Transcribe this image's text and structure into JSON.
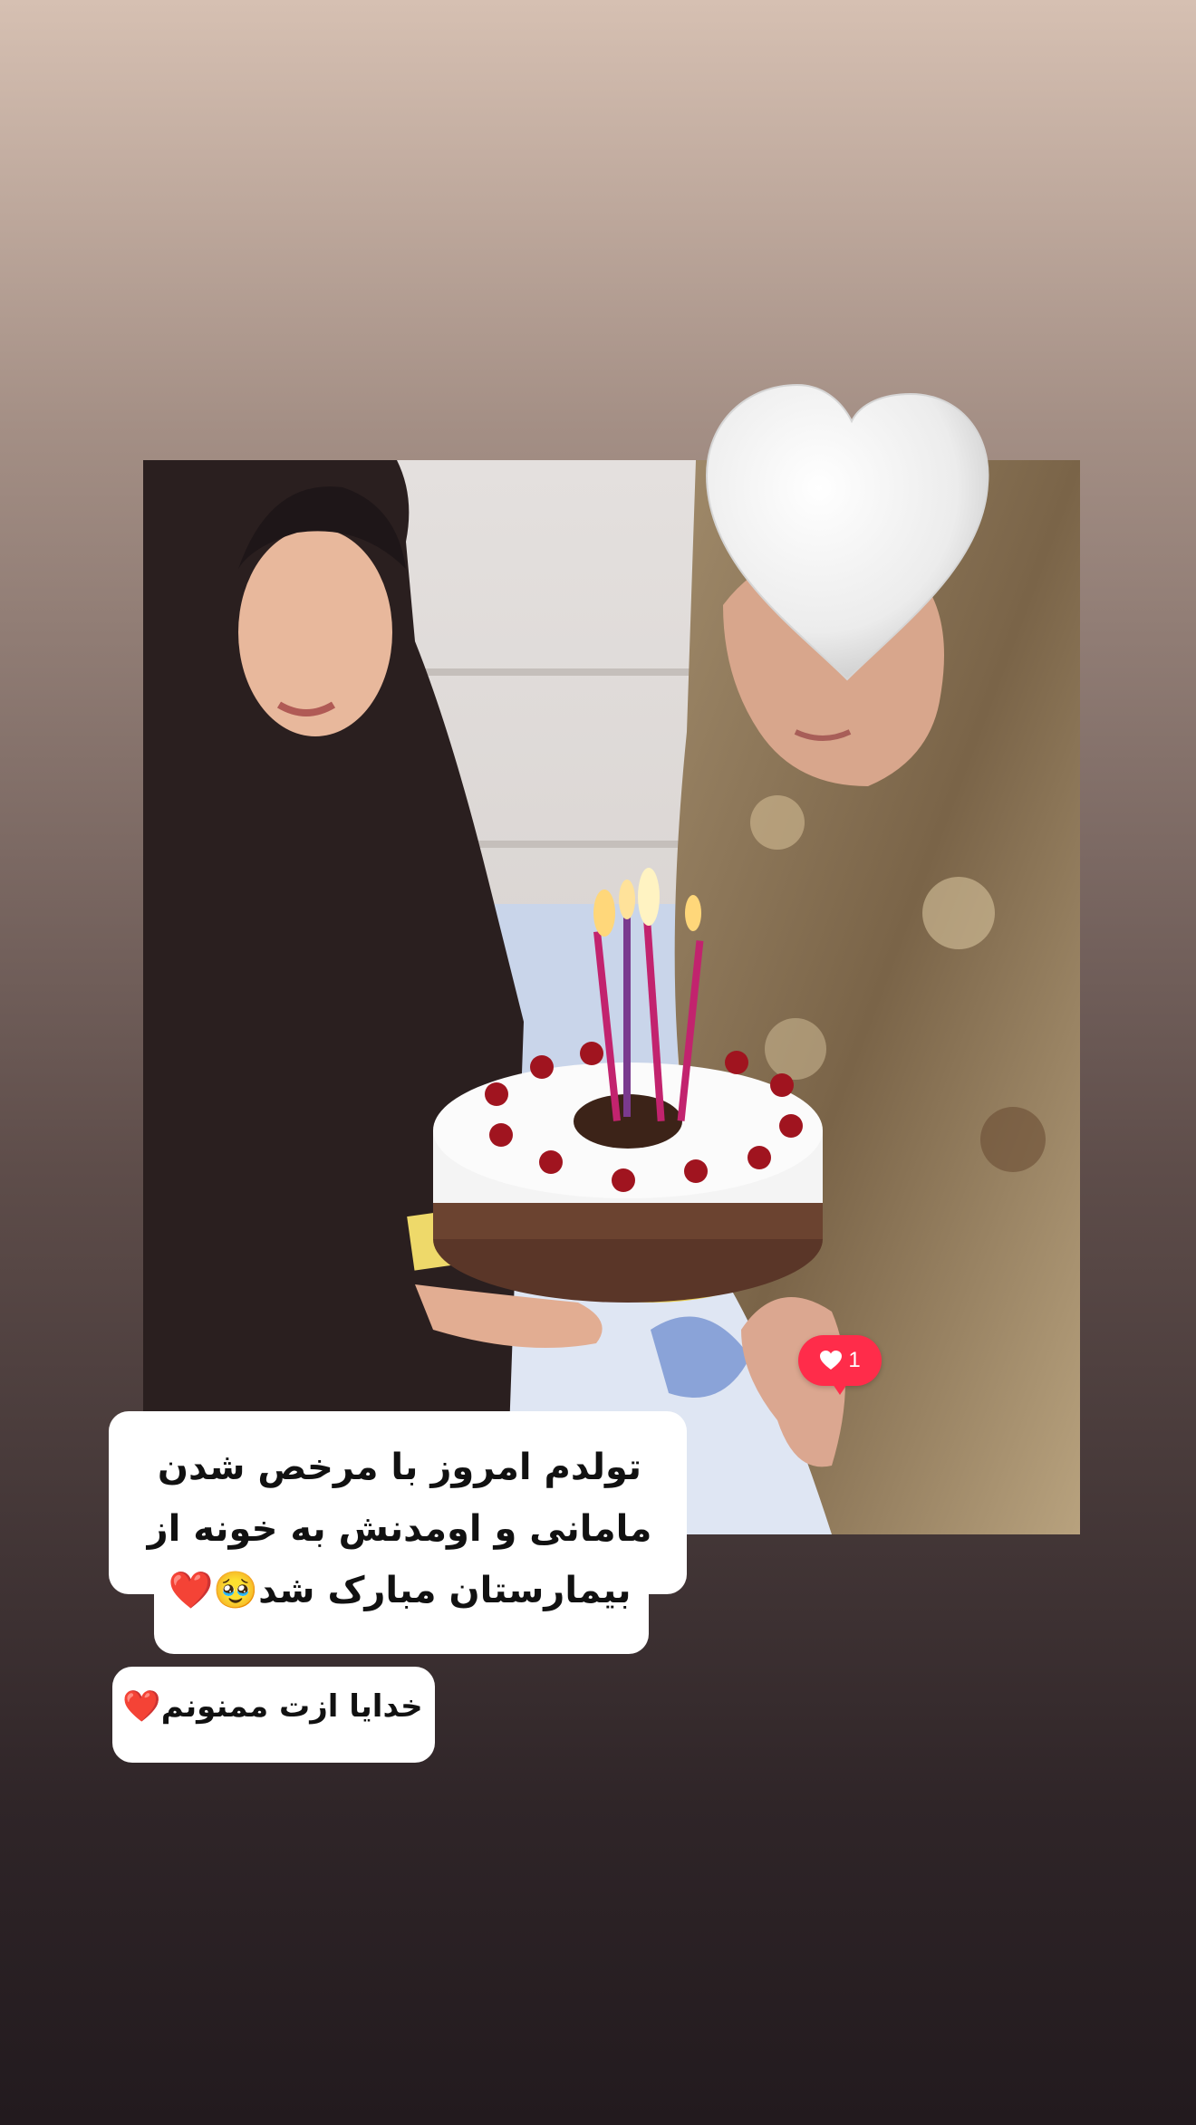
{
  "caption_lines": [
    "تولدم امروز با مرخص شدن",
    "مامانی و اومدنش به خونه از",
    "بیمارستان مبارک شد🥹❤️"
  ],
  "caption_2": "خدایا ازت ممنونم❤️",
  "like_badge": {
    "count": "1",
    "icon": "heart-icon",
    "color": "#ff2c4a"
  },
  "sticker": {
    "icon": "white-heart-icon"
  }
}
